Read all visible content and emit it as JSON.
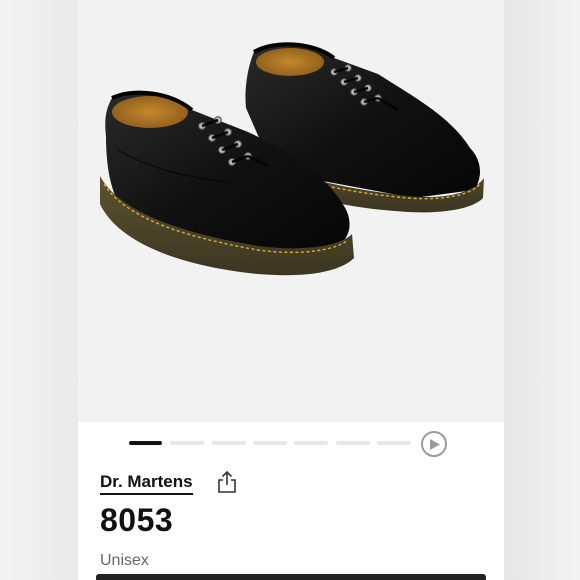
{
  "product": {
    "brand": "Dr. Martens",
    "model": "8053",
    "gender": "Unisex"
  },
  "carousel": {
    "slide_count": 7,
    "active_index": 0
  },
  "icons": {
    "share": "share-icon",
    "play": "play-icon"
  },
  "colors": {
    "active_dot": "#111111",
    "inactive_dot": "#e7e7e7",
    "hero_background": "#f2f2f2"
  }
}
